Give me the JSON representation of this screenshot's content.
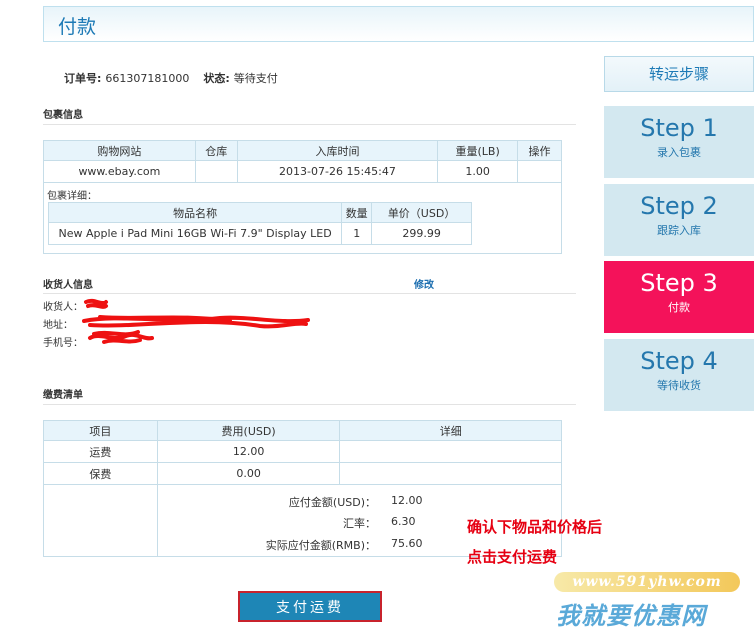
{
  "page": {
    "title": "付款"
  },
  "order": {
    "number_label": "订单号:",
    "number": "661307181000",
    "status_label": "状态:",
    "status": "等待支付"
  },
  "package": {
    "section_title": "包裹信息",
    "headers": [
      "购物网站",
      "仓库",
      "入库时间",
      "重量(LB)",
      "操作"
    ],
    "row": [
      "www.ebay.com",
      "",
      "2013-07-26 15:45:47",
      "1.00",
      ""
    ],
    "detail_label": "包裹详细：",
    "detail_headers": [
      "物品名称",
      "数量",
      "单价（USD）"
    ],
    "detail_row": [
      "New Apple i Pad Mini 16GB Wi-Fi 7.9\" Display LED",
      "1",
      "299.99"
    ]
  },
  "recipient": {
    "section_title": "收货人信息",
    "edit_label": "修改",
    "name_label": "收货人：",
    "address_label": "地址：",
    "phone_label": "手机号："
  },
  "fees": {
    "section_title": "缴费清单",
    "headers": [
      "项目",
      "费用(USD)",
      "详细"
    ],
    "rows": [
      [
        "运费",
        "12.00",
        ""
      ],
      [
        "保费",
        "0.00",
        ""
      ]
    ],
    "summary": [
      {
        "label": "应付金额(USD)：",
        "value": "12.00"
      },
      {
        "label": "汇率：",
        "value": "6.30"
      },
      {
        "label": "实际应付金额(RMB)：",
        "value": "75.60"
      }
    ]
  },
  "annotation": {
    "line1": "确认下物品和价格后",
    "line2": "点击支付运费",
    "color": "#e60012"
  },
  "pay_button": "支付运费",
  "steps": {
    "title": "转运步骤",
    "items": [
      {
        "big": "Step 1",
        "small": "录入包裹",
        "active": false
      },
      {
        "big": "Step 2",
        "small": "跟踪入库",
        "active": false
      },
      {
        "big": "Step 3",
        "small": "付款",
        "active": true
      },
      {
        "big": "Step 4",
        "small": "等待收货",
        "active": false
      }
    ],
    "active_color": "#f4125a",
    "inactive_color": "#d3e8f0"
  },
  "watermark": {
    "url": "www.591yhw.com",
    "text": "我就要优惠网"
  }
}
